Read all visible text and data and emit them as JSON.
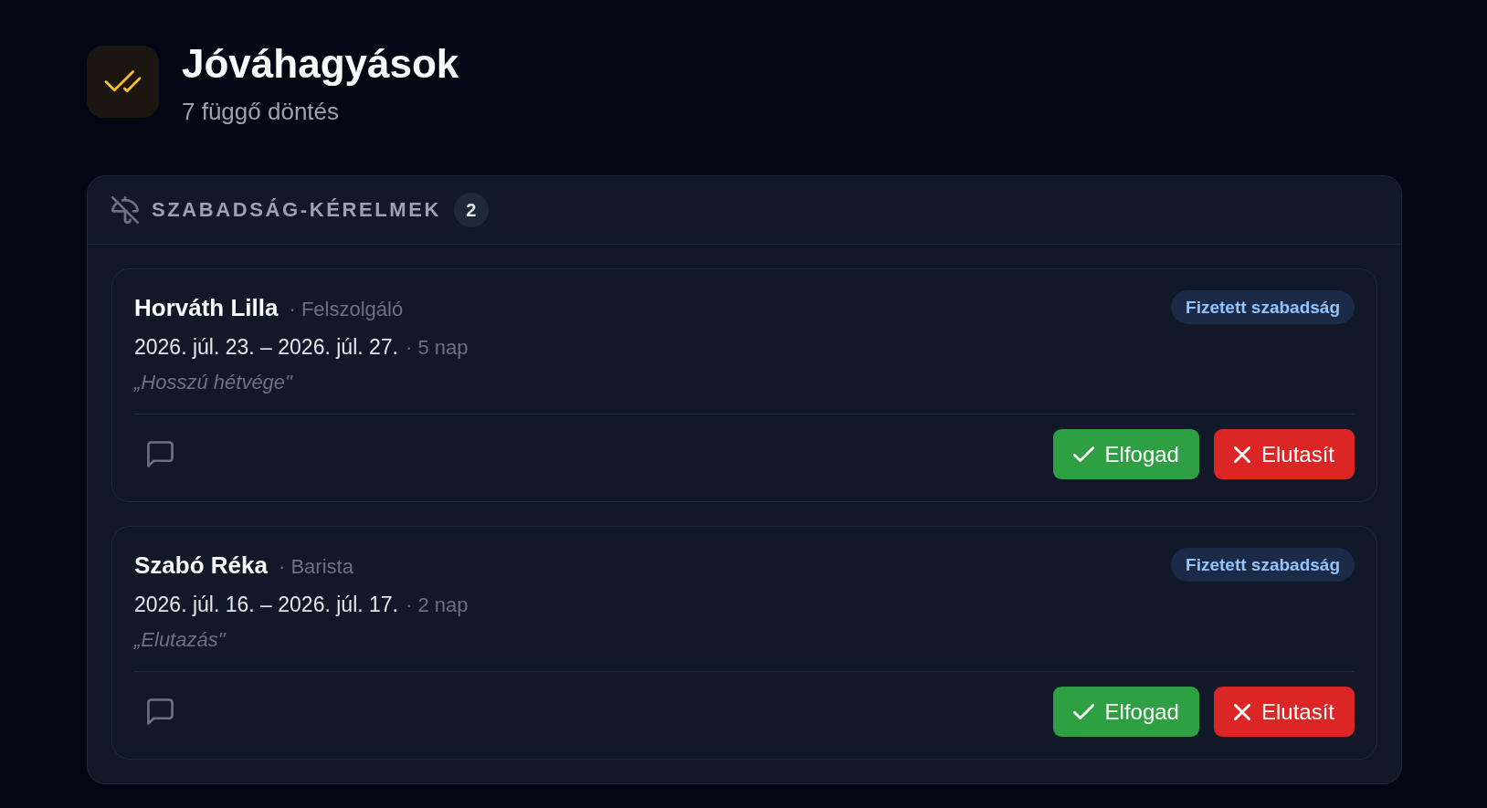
{
  "header": {
    "title": "Jóváhagyások",
    "subtitle": "7 függő döntés"
  },
  "sections": [
    {
      "title": "SZABADSÁG-KÉRELMEK",
      "count": "2",
      "requests": [
        {
          "name": "Horváth Lilla",
          "role": "· Felszolgáló",
          "dates": "2026. júl. 23. – 2026. júl. 27.",
          "duration": "· 5 nap",
          "note": "„Hosszú hétvége\"",
          "type": "Fizetett szabadság",
          "actions": [
            {
              "kind": "approve",
              "label": "Elfogad"
            },
            {
              "kind": "reject",
              "label": "Elutasít"
            }
          ]
        },
        {
          "name": "Szabó Réka",
          "role": "· Barista",
          "dates": "2026. júl. 16. – 2026. júl. 17.",
          "duration": "· 2 nap",
          "note": "„Elutazás\"",
          "type": "Fizetett szabadság",
          "actions": [
            {
              "kind": "approve",
              "label": "Elfogad"
            },
            {
              "kind": "reject",
              "label": "Elutasít"
            }
          ]
        }
      ]
    }
  ]
}
